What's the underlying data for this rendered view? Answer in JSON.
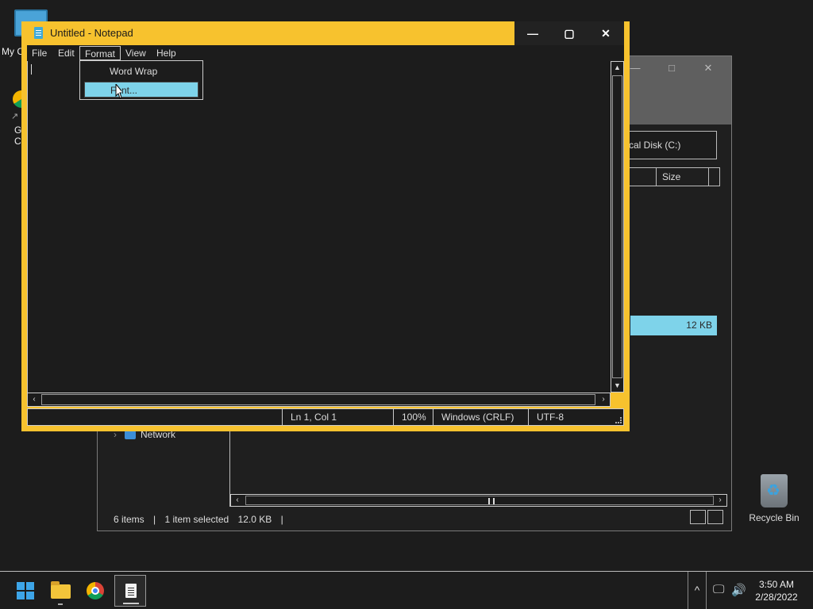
{
  "desktop": {
    "icons": {
      "my_computer": "My C",
      "google_chrome_label": "G\nC",
      "recycle_bin": "Recycle Bin"
    }
  },
  "explorer": {
    "controls": {
      "minimize": "—",
      "maximize": "□",
      "close": "✕"
    },
    "address": "cal Disk (C:)",
    "column_size": "Size",
    "selected_row_size": "12 KB",
    "nav_network": "Network",
    "status": {
      "items": "6 items",
      "sep": "|",
      "selected": "1 item selected",
      "size": "12.0 KB"
    }
  },
  "notepad": {
    "title": "Untitled - Notepad",
    "controls": {
      "minimize": "—",
      "maximize": "▢",
      "close": "✕"
    },
    "menu": [
      "File",
      "Edit",
      "Format",
      "View",
      "Help"
    ],
    "format_menu": {
      "items": [
        "Word Wrap",
        "Font..."
      ],
      "highlighted_index": 1
    },
    "status": {
      "position": "Ln 1, Col 1",
      "zoom": "100%",
      "line_ending": "Windows (CRLF)",
      "encoding": "UTF-8"
    }
  },
  "taskbar": {
    "apps": [
      "start-icon",
      "file-explorer-icon",
      "chrome-icon",
      "notepad-icon"
    ],
    "active_app": "notepad-icon",
    "tray_overflow": "^",
    "clock": {
      "time": "3:50 AM",
      "date": "2/28/2022"
    }
  },
  "colors": {
    "notepad_border": "#f7c22e",
    "highlight": "#7ed3ea",
    "background": "#1c1c1c"
  }
}
